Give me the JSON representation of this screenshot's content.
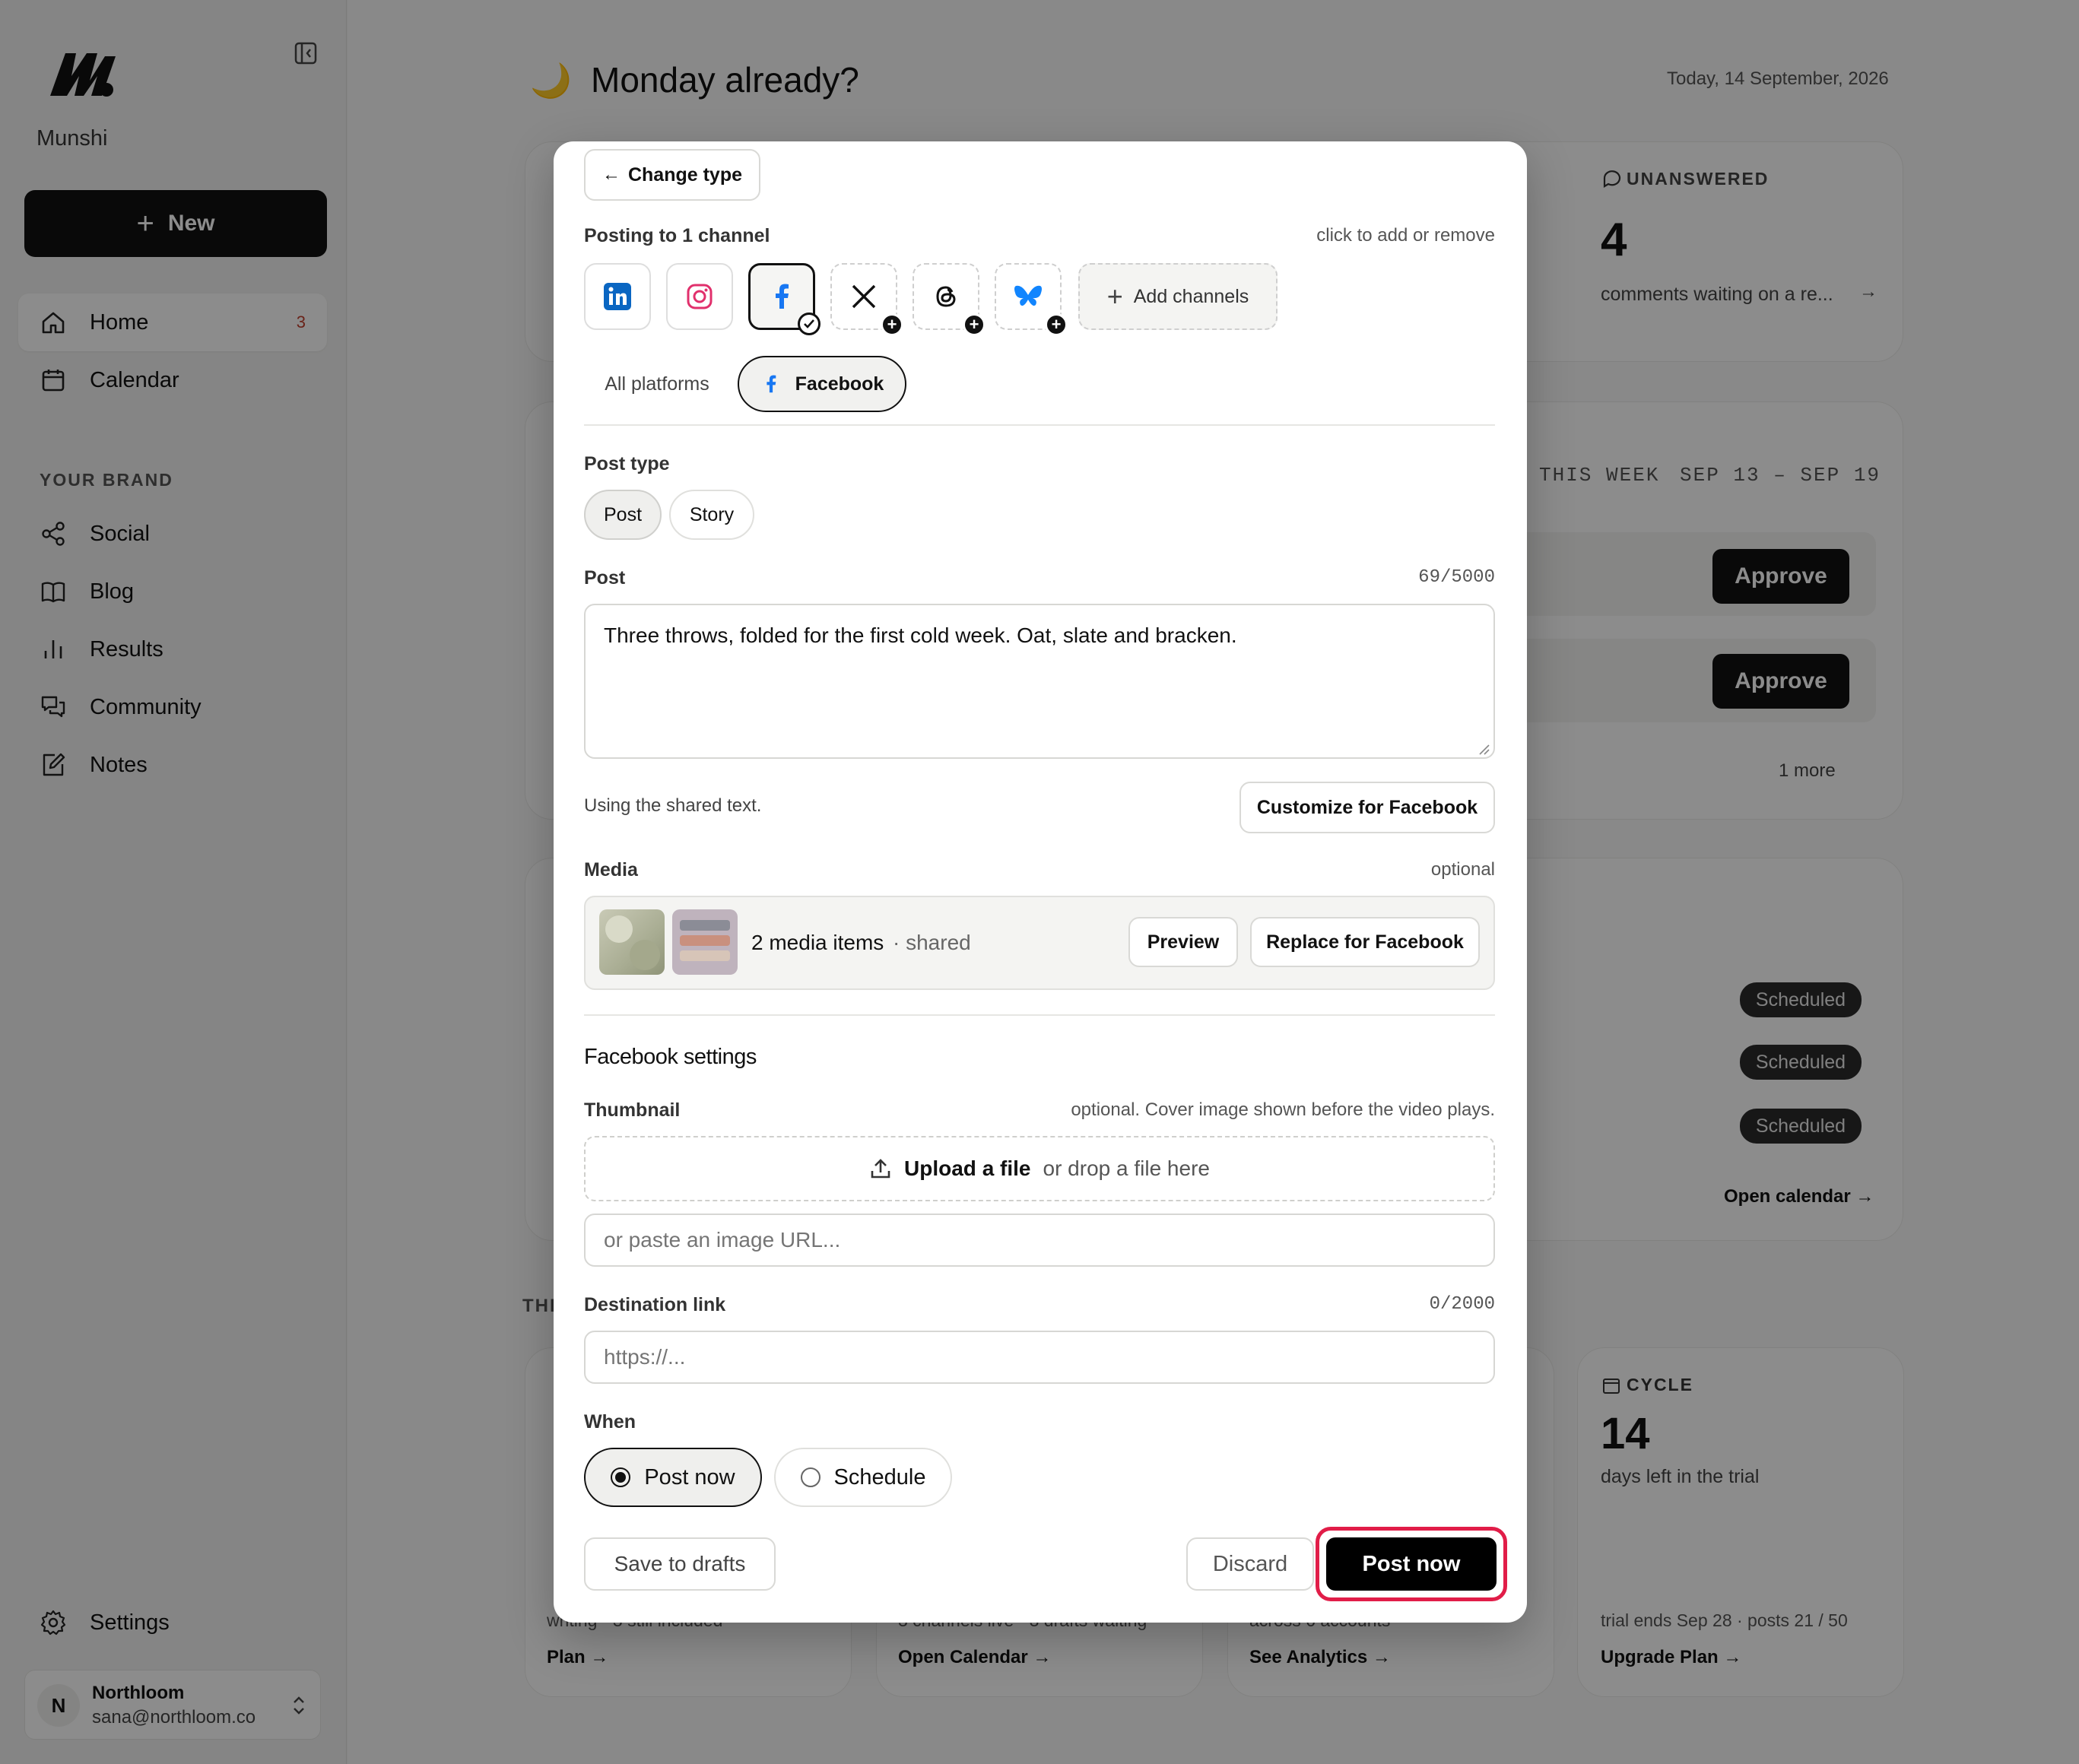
{
  "sidebar": {
    "brand": "Munshi",
    "new_button": "New",
    "nav": [
      {
        "label": "Home",
        "count": "3"
      },
      {
        "label": "Calendar"
      }
    ],
    "section_label": "YOUR BRAND",
    "brand_nav": [
      {
        "label": "Social"
      },
      {
        "label": "Blog"
      },
      {
        "label": "Results"
      },
      {
        "label": "Community"
      },
      {
        "label": "Notes"
      }
    ],
    "settings": "Settings",
    "account": {
      "initial": "N",
      "name": "Northloom",
      "email": "sana@northloom.co"
    }
  },
  "dashboard": {
    "greeting": "Monday already?",
    "date": "Today, 14 September, 2026",
    "unanswered": {
      "label": "UNANSWERED",
      "value": "4",
      "desc": "comments waiting on a re..."
    },
    "week": {
      "label": "THIS WEEK",
      "range": "SEP 13 – SEP 19",
      "approve": "Approve",
      "more": "1 more"
    },
    "scheduled_badge": "Scheduled",
    "open_calendar_link": "Open calendar →",
    "section_prefix": "THI",
    "cycle": {
      "label": "CYCLE",
      "value": "14",
      "desc": "days left in the trial",
      "foot": "trial ends Sep 28 · posts 21 / 50",
      "link": "Upgrade Plan →"
    },
    "bottom_links": [
      "Plan →",
      "Open Calendar →",
      "See Analytics →"
    ],
    "bottom_foot": [
      "writing · 3 still included",
      "3 channels live · 3 drafts waiting",
      "across 6 accounts"
    ]
  },
  "modal": {
    "change_type": "Change type",
    "posting_to": "Posting to 1 channel",
    "posting_hint": "click to add or remove",
    "channels": [
      {
        "name": "linkedin-icon",
        "color": "#0a66c2"
      },
      {
        "name": "instagram-icon",
        "color": "#e1306c"
      },
      {
        "name": "facebook-icon",
        "color": "#1877f2"
      },
      {
        "name": "x-icon",
        "color": "#111111"
      },
      {
        "name": "threads-icon",
        "color": "#111111"
      },
      {
        "name": "bluesky-icon",
        "color": "#1185fe"
      }
    ],
    "add_channels": "Add channels",
    "tabs": {
      "all": "All platforms",
      "facebook": "Facebook"
    },
    "post_type_label": "Post type",
    "post_types": [
      "Post",
      "Story"
    ],
    "post_label": "Post",
    "post_count": "69/5000",
    "post_text": "Three throws, folded for the first cold week. Oat, slate and bracken.",
    "shared_text_note": "Using the shared text.",
    "customize_button": "Customize for Facebook",
    "media_label": "Media",
    "media_optional": "optional",
    "media_count": "2 media items",
    "media_shared": "· shared",
    "preview_button": "Preview",
    "replace_button": "Replace for Facebook",
    "fb_settings": "Facebook settings",
    "thumbnail_label": "Thumbnail",
    "thumbnail_hint": "optional. Cover image shown before the video plays.",
    "upload_strong": "Upload a file",
    "upload_rest": "or drop a file here",
    "image_url_placeholder": "or paste an image URL...",
    "dest_label": "Destination link",
    "dest_count": "0/2000",
    "dest_placeholder": "https://...",
    "when_label": "When",
    "when_options": [
      "Post now",
      "Schedule"
    ],
    "save_drafts": "Save to drafts",
    "discard": "Discard",
    "post_now": "Post now",
    "highlight_color": "#e11d48"
  }
}
